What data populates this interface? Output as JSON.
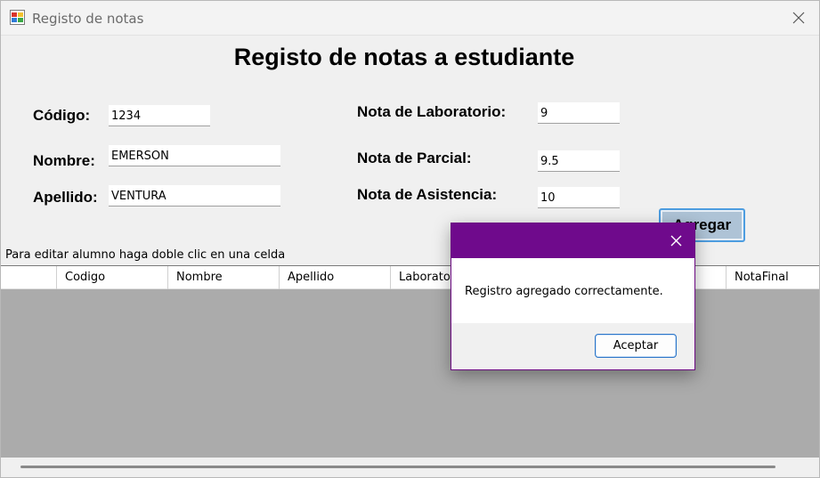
{
  "window": {
    "title": "Registo de notas",
    "close_icon": "close-icon"
  },
  "form": {
    "heading": "Registo de notas a estudiante",
    "codigo_label": "Código:",
    "codigo_value": "1234",
    "nombre_label": "Nombre:",
    "nombre_value": "EMERSON",
    "apellido_label": "Apellido:",
    "apellido_value": "VENTURA",
    "lab_label": "Nota de Laboratorio:",
    "lab_value": "9",
    "parcial_label": "Nota de Parcial:",
    "parcial_value": "9.5",
    "asistencia_label": "Nota de Asistencia:",
    "asistencia_value": "10",
    "agregar_label": "Agregar"
  },
  "grid": {
    "hint": "Para editar alumno haga doble clic en una celda",
    "columns": [
      "",
      "Codigo",
      "Nombre",
      "Apellido",
      "Laboratorio",
      "",
      "",
      "NotaFinal"
    ]
  },
  "dialog": {
    "message": "Registro agregado correctamente.",
    "ok_label": "Aceptar",
    "title_color": "#6f0a8c"
  },
  "colors": {
    "dialog_bar": "#6f0a8c",
    "button_focus": "#4d9de0"
  }
}
